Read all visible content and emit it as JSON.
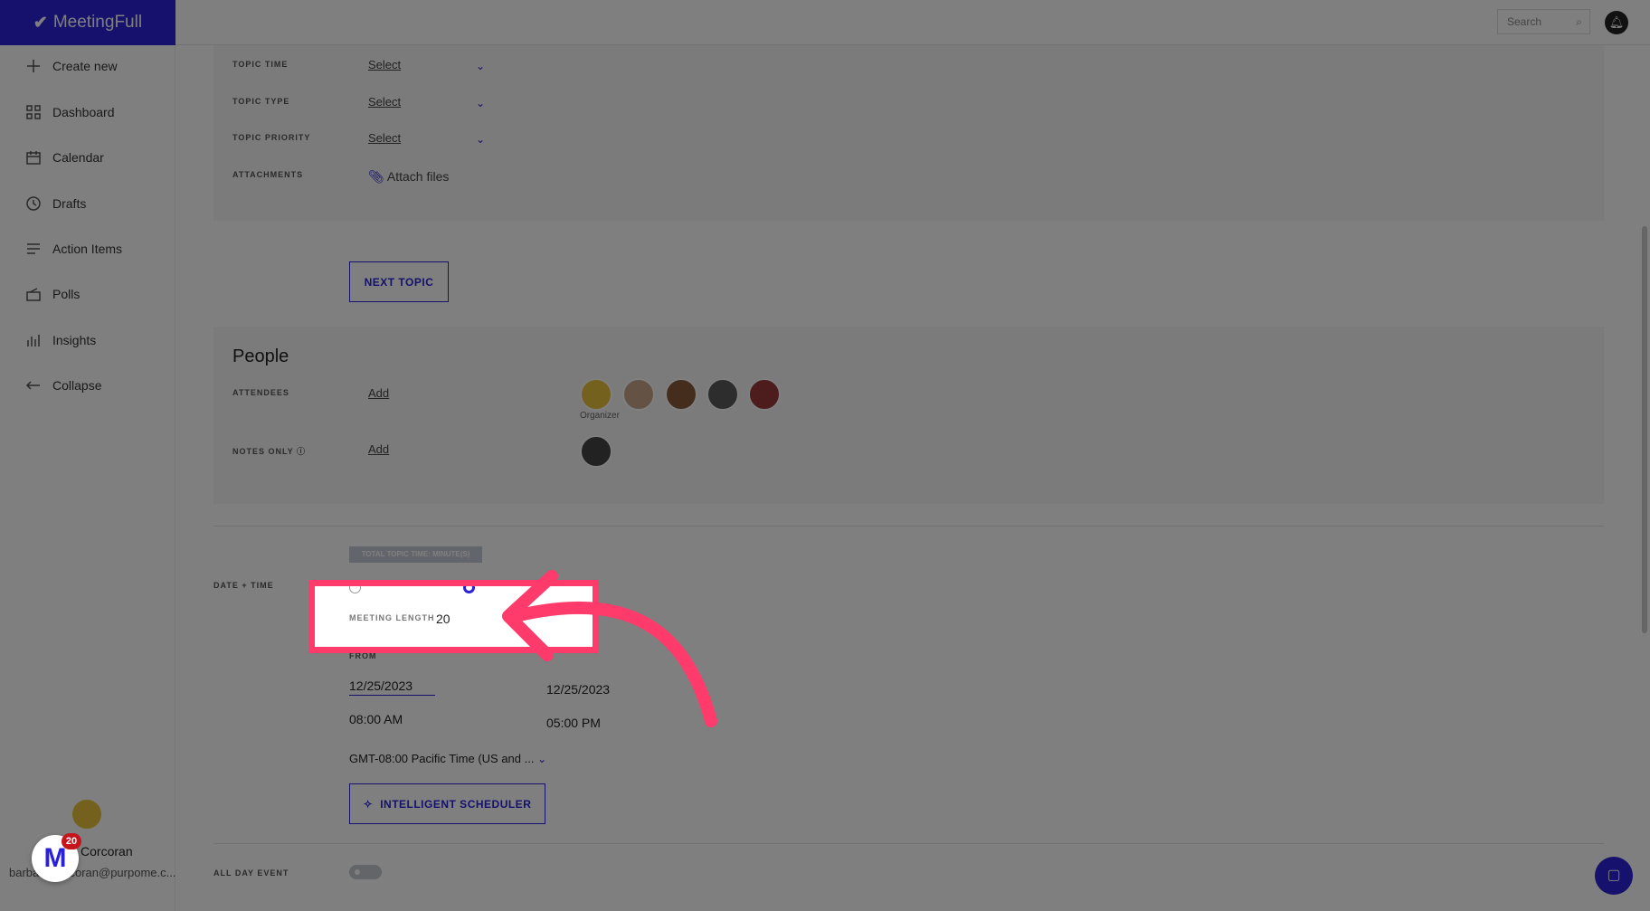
{
  "app": {
    "name": "MeetingFull"
  },
  "sidebar": {
    "items": [
      {
        "label": "Create new",
        "icon": "plus-icon"
      },
      {
        "label": "Dashboard",
        "icon": "grid-icon"
      },
      {
        "label": "Calendar",
        "icon": "calendar-icon"
      },
      {
        "label": "Drafts",
        "icon": "clock-icon"
      },
      {
        "label": "Action Items",
        "icon": "list-icon"
      },
      {
        "label": "Polls",
        "icon": "poll-icon"
      },
      {
        "label": "Insights",
        "icon": "bar-chart-icon"
      },
      {
        "label": "Collapse",
        "icon": "arrow-left-icon"
      }
    ],
    "user": {
      "name": "a Corcoran",
      "email": "barbara.corcoran@purpome.c..."
    },
    "widget": {
      "badge": "20"
    }
  },
  "header": {
    "search_placeholder": "Search"
  },
  "topic": {
    "rows": [
      {
        "label": "TOPIC TIME",
        "value": "Select"
      },
      {
        "label": "TOPIC TYPE",
        "value": "Select"
      },
      {
        "label": "TOPIC PRIORITY",
        "value": "Select"
      }
    ],
    "attachments_label": "ATTACHMENTS",
    "attach_link": "Attach files",
    "next_button": "NEXT TOPIC"
  },
  "people": {
    "title": "People",
    "attendees_label": "ATTENDEES",
    "notes_label": "NOTES ONLY",
    "add": "Add",
    "organizer": "Organizer"
  },
  "datetime": {
    "badge": "TOTAL TOPIC TIME: MINUTE(S)",
    "label": "DATE + TIME",
    "meeting_length_label": "MEETING LENGTH",
    "meeting_length": "20",
    "from_label": "FROM",
    "from_date": "12/25/2023",
    "to_date": "12/25/2023",
    "from_time": "08:00 AM",
    "to_time": "05:00 PM",
    "timezone": "GMT-08:00 Pacific Time (US and ...",
    "scheduler_button": "INTELLIGENT SCHEDULER",
    "all_day_label": "ALL DAY EVENT",
    "all_day": false
  },
  "colors": {
    "brand": "#2a22d8",
    "highlight": "#ff3b6b"
  }
}
